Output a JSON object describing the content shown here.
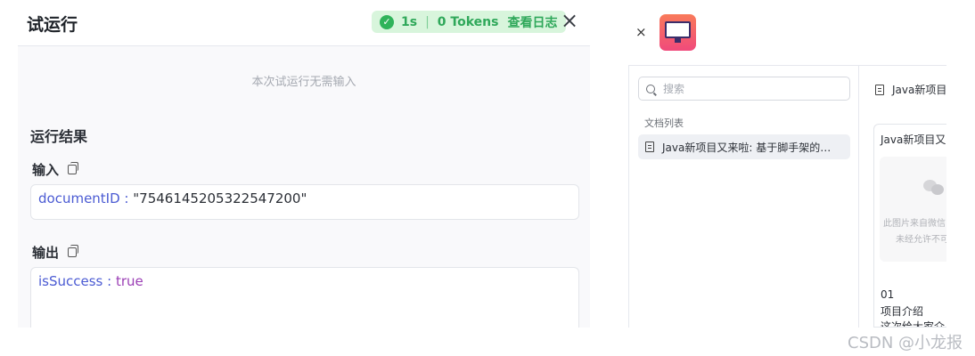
{
  "left_panel": {
    "title": "试运行",
    "status": {
      "duration": "1s",
      "tokens": "0 Tokens",
      "log_link": "查看日志"
    },
    "close_symbol": "×",
    "no_input_hint": "本次试运行无需输入",
    "result_title": "运行结果",
    "input_label": "输入",
    "input": {
      "key": "documentID",
      "sep": " : ",
      "value": "\"7546145205322547200\""
    },
    "output_label": "输出",
    "output": {
      "key": "isSuccess",
      "sep": " : ",
      "value": "true"
    }
  },
  "right_panel": {
    "close_symbol": "×",
    "search_placeholder": "搜索",
    "list_header": "文档列表",
    "doc_item": "Java新项目又来啦: 基于脚手架的…",
    "tab_title": "Java新项目",
    "card": {
      "title": "Java新项目又",
      "placeholder_line1": "此图片来自微信",
      "placeholder_line2": "未经允许不可",
      "line1": "01",
      "line2": "项目介绍",
      "line3": "这次给大家介"
    }
  },
  "watermark": "CSDN @小龙报",
  "colors": {
    "success_bg": "#d8f5dc",
    "success_text": "#2fa85a",
    "key": "#4b5bd3",
    "bool": "#9b3fb5"
  }
}
